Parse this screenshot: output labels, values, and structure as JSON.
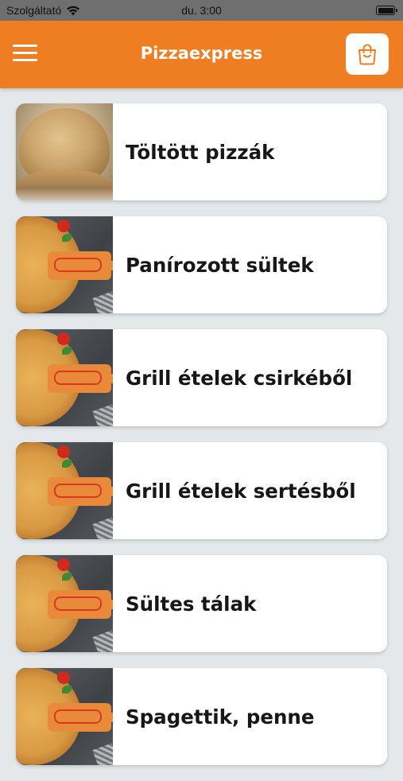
{
  "status_bar": {
    "carrier": "Szolgáltató",
    "time": "du. 3:00"
  },
  "header": {
    "title": "Pizzaexpress"
  },
  "categories": [
    {
      "label": "Töltött pizzák",
      "image": "calzone"
    },
    {
      "label": "Panírozott sültek",
      "image": "pizza"
    },
    {
      "label": "Grill ételek csirkéből",
      "image": "pizza"
    },
    {
      "label": "Grill ételek sertésből",
      "image": "pizza"
    },
    {
      "label": "Sültes tálak",
      "image": "pizza"
    },
    {
      "label": "Spagettik, penne",
      "image": "pizza"
    }
  ],
  "colors": {
    "accent": "#ef7e22",
    "background": "#e4e8ea"
  },
  "icons": {
    "menu": "hamburger-menu-icon",
    "cart": "shopping-bag-icon",
    "wifi": "wifi-icon",
    "battery": "battery-icon"
  }
}
